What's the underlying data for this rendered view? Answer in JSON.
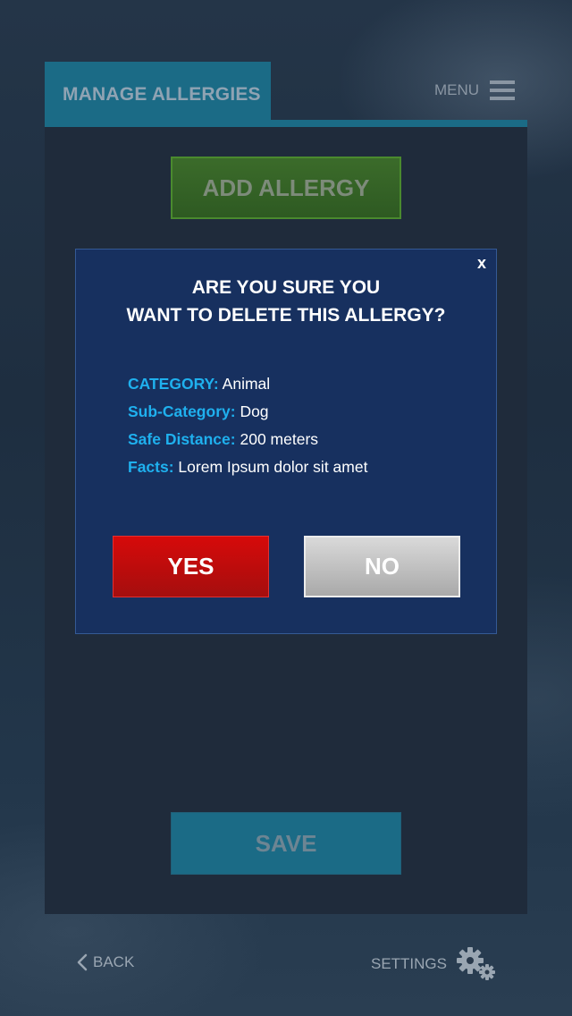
{
  "header": {
    "tab_title": "MANAGE ALLERGIES",
    "menu_label": "MENU",
    "menu_icon": "hamburger-icon"
  },
  "main": {
    "add_button_label": "ADD ALLERGY",
    "save_button_label": "SAVE"
  },
  "dialog": {
    "close_label": "x",
    "title_line1": "ARE YOU SURE YOU",
    "title_line2": "WANT TO DELETE THIS ALLERGY?",
    "details": [
      {
        "key": "CATEGORY:",
        "value": "Animal"
      },
      {
        "key": "Sub-Category:",
        "value": "Dog"
      },
      {
        "key": "Safe Distance:",
        "value": "200 meters"
      },
      {
        "key": "Facts:",
        "value": "Lorem Ipsum dolor sit amet"
      }
    ],
    "yes_label": "YES",
    "no_label": "NO"
  },
  "footer": {
    "back_label": "BACK",
    "back_icon": "chevron-left-icon",
    "settings_label": "SETTINGS",
    "settings_icon": "gears-icon"
  },
  "colors": {
    "accent_teal": "#1b6b86",
    "dialog_bg": "#17305f",
    "detail_key": "#1fb0ee",
    "yes_red": "#d60a0a",
    "add_green": "#3b6b2a"
  }
}
